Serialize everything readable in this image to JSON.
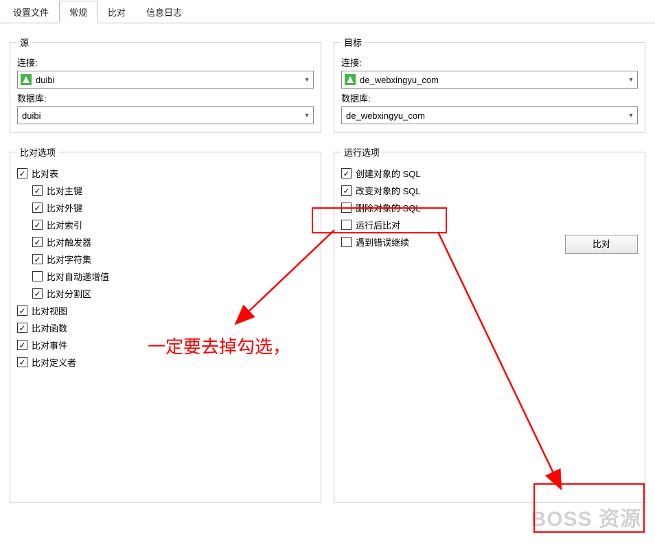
{
  "tabs": {
    "t0": "设置文件",
    "t1": "常规",
    "t2": "比对",
    "t3": "信息日志"
  },
  "source": {
    "legend": "源",
    "conn_label": "连接:",
    "conn_value": "duibi",
    "db_label": "数据库:",
    "db_value": "duibi"
  },
  "target": {
    "legend": "目标",
    "conn_label": "连接:",
    "conn_value": "de_webxingyu_com",
    "db_label": "数据库:",
    "db_value": "de_webxingyu_com"
  },
  "compare_options": {
    "legend": "比对选项",
    "items": {
      "cmp_table": "比对表",
      "cmp_pk": "比对主键",
      "cmp_fk": "比对外键",
      "cmp_idx": "比对索引",
      "cmp_trig": "比对触发器",
      "cmp_charset": "比对字符集",
      "cmp_autoinc": "比对自动递增值",
      "cmp_partition": "比对分割区",
      "cmp_view": "比对视图",
      "cmp_func": "比对函数",
      "cmp_event": "比对事件",
      "cmp_definer": "比对定义者"
    }
  },
  "run_options": {
    "legend": "运行选项",
    "items": {
      "run_create": "创建对象的 SQL",
      "run_alter": "改变对象的 SQL",
      "run_drop": "删除对象的 SQL",
      "run_after": "运行后比对",
      "run_continue": "遇到错误继续"
    }
  },
  "compare_button": "比对",
  "annotation": "一定要去掉勾选，",
  "watermark": "BOSS 资源"
}
